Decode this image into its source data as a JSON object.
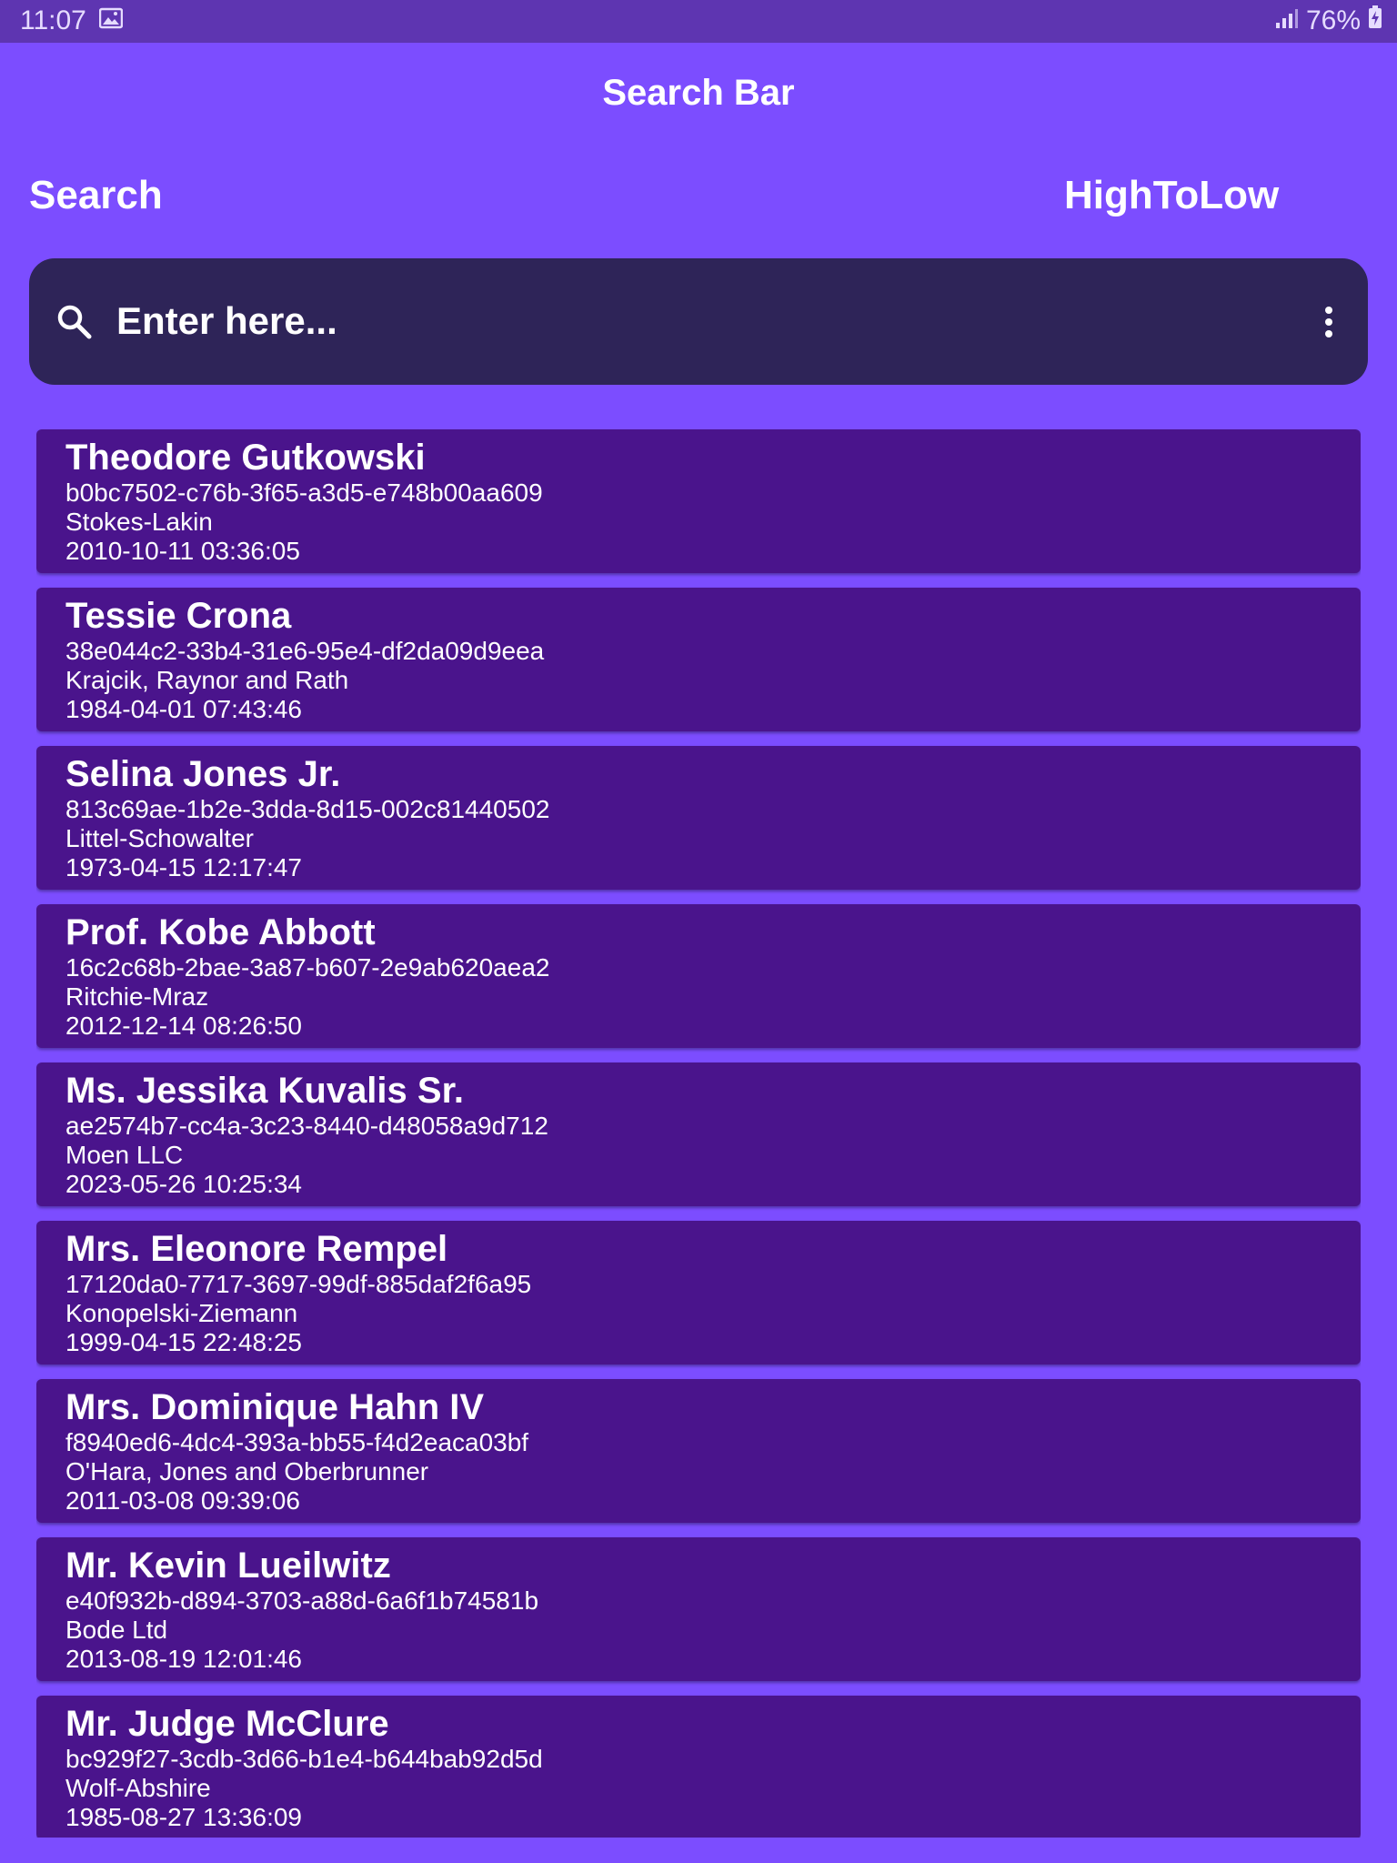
{
  "status_bar": {
    "time": "11:07",
    "battery": "76%"
  },
  "app_bar": {
    "title": "Search Bar"
  },
  "controls": {
    "search_label": "Search",
    "sort_label": "HighToLow"
  },
  "search": {
    "placeholder": "Enter here..."
  },
  "icons": {
    "search": "search-icon",
    "more": "more-vert-icon",
    "gallery": "image-icon",
    "signal": "signal-icon",
    "battery": "battery-charging-icon"
  },
  "colors": {
    "background": "#7c4dff",
    "status_bar": "#5e35b1",
    "search_box": "#2e2458",
    "card": "#4a148c",
    "text": "#ffffff"
  },
  "items": [
    {
      "name": "Theodore Gutkowski",
      "id": "b0bc7502-c76b-3f65-a3d5-e748b00aa609",
      "company": "Stokes-Lakin",
      "date": "2010-10-11 03:36:05"
    },
    {
      "name": "Tessie Crona",
      "id": "38e044c2-33b4-31e6-95e4-df2da09d9eea",
      "company": "Krajcik, Raynor and Rath",
      "date": "1984-04-01 07:43:46"
    },
    {
      "name": "Selina Jones Jr.",
      "id": "813c69ae-1b2e-3dda-8d15-002c81440502",
      "company": "Littel-Schowalter",
      "date": "1973-04-15 12:17:47"
    },
    {
      "name": "Prof. Kobe Abbott",
      "id": "16c2c68b-2bae-3a87-b607-2e9ab620aea2",
      "company": "Ritchie-Mraz",
      "date": "2012-12-14 08:26:50"
    },
    {
      "name": "Ms. Jessika Kuvalis Sr.",
      "id": "ae2574b7-cc4a-3c23-8440-d48058a9d712",
      "company": "Moen LLC",
      "date": "2023-05-26 10:25:34"
    },
    {
      "name": "Mrs. Eleonore Rempel",
      "id": "17120da0-7717-3697-99df-885daf2f6a95",
      "company": "Konopelski-Ziemann",
      "date": "1999-04-15 22:48:25"
    },
    {
      "name": "Mrs. Dominique Hahn IV",
      "id": "f8940ed6-4dc4-393a-bb55-f4d2eaca03bf",
      "company": "O'Hara, Jones and Oberbrunner",
      "date": "2011-03-08 09:39:06"
    },
    {
      "name": "Mr. Kevin Lueilwitz",
      "id": "e40f932b-d894-3703-a88d-6a6f1b74581b",
      "company": "Bode Ltd",
      "date": "2013-08-19 12:01:46"
    },
    {
      "name": "Mr. Judge McClure",
      "id": "bc929f27-3cdb-3d66-b1e4-b644bab92d5d",
      "company": "Wolf-Abshire",
      "date": "1985-08-27 13:36:09"
    }
  ]
}
